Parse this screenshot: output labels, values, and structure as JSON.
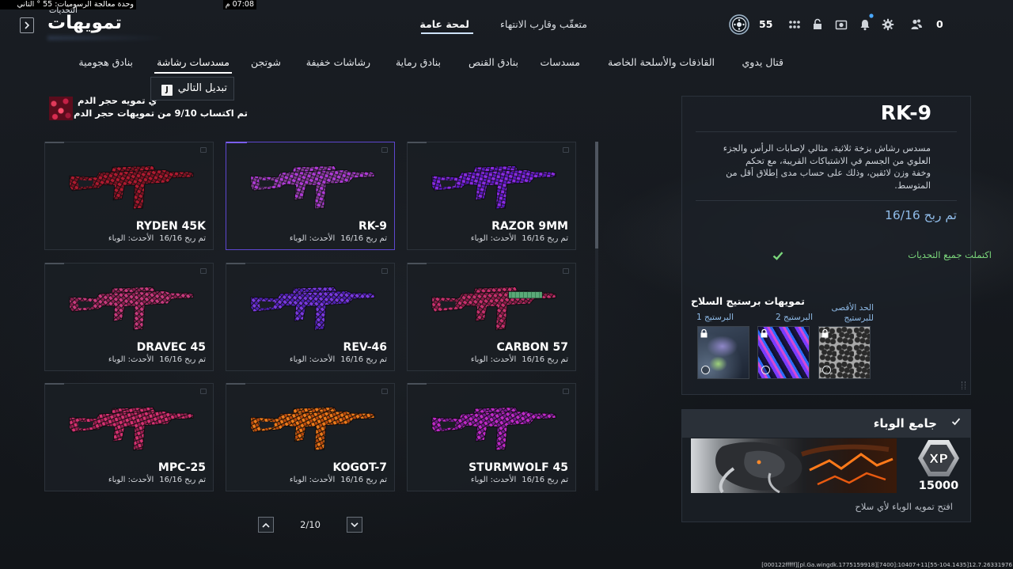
{
  "overlay": {
    "gpu": "وحدة معالجة الرسوميات: 55 ° التاني",
    "clock": "07:08 م"
  },
  "header": {
    "subtitle": "التحديات",
    "title": "تمويهات"
  },
  "top_tabs": {
    "overview": "لمحة عامة",
    "tracker": "متعقّب وقارب الانتهاء",
    "active": "overview"
  },
  "player": {
    "level": "55",
    "currency": "0"
  },
  "categories": [
    "قتال يدوي",
    "القاذفات والأسلحة الخاصة",
    "مسدسات",
    "بنادق القنص",
    "بنادق رماية",
    "رشاشات خفيفة",
    "شوتجن",
    "مسدسات رشاشة",
    "بنادق هجومية"
  ],
  "active_category": "مسدسات رشاشة",
  "tooltip": {
    "label": "تبديل التالي",
    "key": "J"
  },
  "camo_header": {
    "line1": "ي تمويه حجر الدم",
    "line2": "تم اكتساب 9/10 من تمويهات حجر الدم"
  },
  "selected_weapon": "RK-9",
  "weapons": [
    {
      "name": "RAZOR 9MM",
      "progress": "تم ربح 16/16",
      "latest": "الأحدث: الوباء",
      "camo": [
        "#8a2be2",
        "#5a18c0",
        "#170f22"
      ]
    },
    {
      "name": "RK-9",
      "progress": "تم ربح 16/16",
      "latest": "الأحدث: الوباء",
      "camo": [
        "#b03ad8",
        "#7d3c8c",
        "#1b1620"
      ]
    },
    {
      "name": "RYDEN 45K",
      "progress": "تم ربح 16/16",
      "latest": "الأحدث: الوباء",
      "camo": [
        "#b01a30",
        "#7a1222",
        "#1a0e10"
      ]
    },
    {
      "name": "CARBON 57",
      "progress": "تم ربح 16/16",
      "latest": "الأحدث: الوباء",
      "camo": [
        "#c8306e",
        "#8a1c48",
        "#1e1216"
      ],
      "accent": "#5aaa78"
    },
    {
      "name": "REV-46",
      "progress": "تم ربح 16/16",
      "latest": "الأحدث: الوباء",
      "camo": [
        "#7a3ae0",
        "#4e20b4",
        "#160f24"
      ]
    },
    {
      "name": "DRAVEC 45",
      "progress": "تم ربح 16/16",
      "latest": "الأحدث: الوباء",
      "camo": [
        "#c83a7e",
        "#8a2050",
        "#1c1016"
      ]
    },
    {
      "name": "STURMWOLF 45",
      "progress": "تم ربح 16/16",
      "latest": "الأحدث: الوباء",
      "camo": [
        "#c02ac8",
        "#7a1a92",
        "#1a0f1e"
      ]
    },
    {
      "name": "KOGOT-7",
      "progress": "تم ربح 16/16",
      "latest": "الأحدث: الوباء",
      "camo": [
        "#ee7a1a",
        "#b84a0e",
        "#1e1208"
      ]
    },
    {
      "name": "MPC-25",
      "progress": "تم ربح 16/16",
      "latest": "الأحدث: الوباء",
      "camo": [
        "#d63272",
        "#9a1c50",
        "#1c0f14"
      ]
    }
  ],
  "pagination": {
    "page": "2/10"
  },
  "detail": {
    "name": "RK-9",
    "description_lines": [
      "مسدس رشاش بزخة ثلاثية، مثالي لإصابات الرأس والجزء",
      "العلوي من الجسم في الاشتباكات القريبة، مع تحكم",
      "وخفة وزن لائقين، وذلك على حساب مدى إطلاق أقل من",
      "المتوسط."
    ],
    "progress": "تم ربح 16/16",
    "status": "اكتملت جميع التحديات",
    "prestige_title": "تمويهات برستيج السلاح",
    "prestige": [
      {
        "label_lines": [
          "الحد الأقصى",
          "للبرستيج"
        ],
        "locked": true
      },
      {
        "label_lines": [
          "البرستيج 2"
        ],
        "locked": true
      },
      {
        "label_lines": [
          "البرستيج 1"
        ],
        "locked": true
      }
    ]
  },
  "reward": {
    "title": "جامع الوباء",
    "xp_label": "XP",
    "xp": "15000",
    "description": "افتح تمويه الوباء لأي سلاح"
  },
  "colors": {
    "selected_border": "#5e47cf",
    "progress_blue": "#8fbbe8",
    "complete_green": "#7bd67b"
  },
  "debug": "[000122fffff][pl.Ga.wingdk.1775159918][7400]:10407+11[55-104.1435]12.7.26331976"
}
